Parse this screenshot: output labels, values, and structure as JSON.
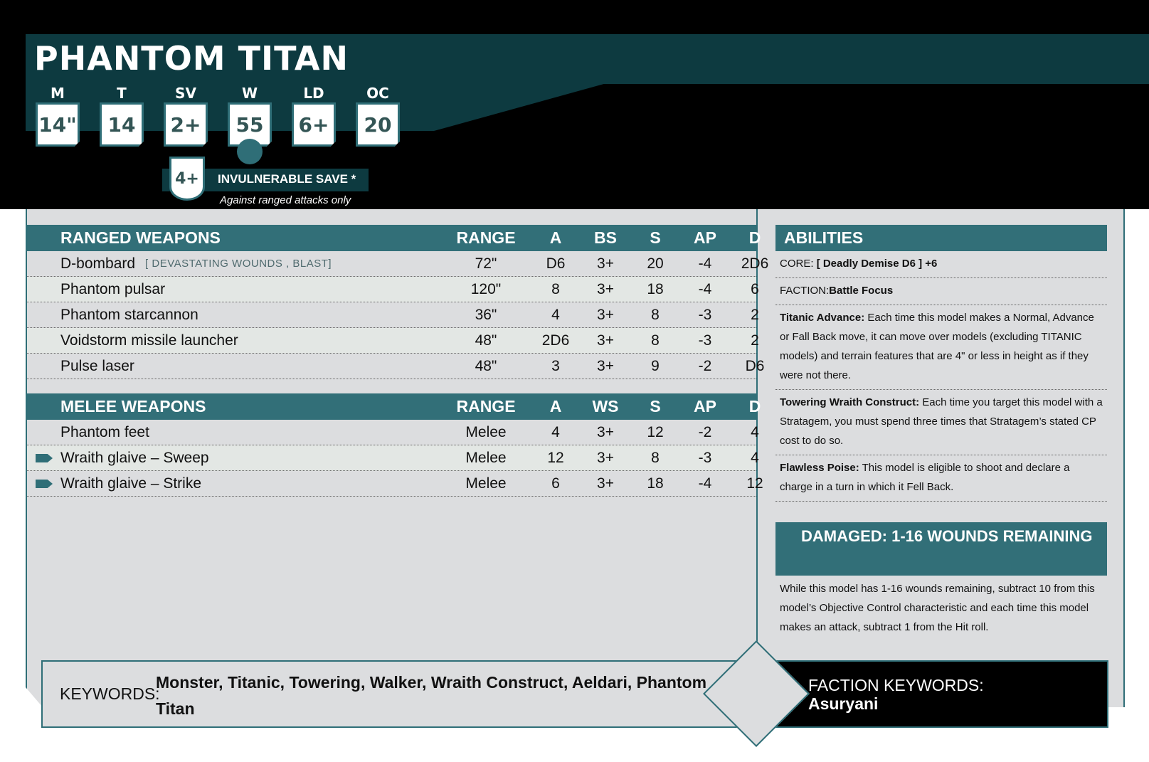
{
  "unit": {
    "name": "PHANTOM TITAN"
  },
  "stats": [
    {
      "label": "M",
      "value": "14\""
    },
    {
      "label": "T",
      "value": "14"
    },
    {
      "label": "SV",
      "value": "2+"
    },
    {
      "label": "W",
      "value": "55"
    },
    {
      "label": "LD",
      "value": "6+"
    },
    {
      "label": "OC",
      "value": "20"
    }
  ],
  "invulnerable": {
    "value": "4+",
    "label": "INVULNERABLE SAVE *",
    "note": "Against ranged attacks only"
  },
  "ranged": {
    "headers": {
      "name": "RANGED WEAPONS",
      "range": "RANGE",
      "a": "A",
      "bs": "BS",
      "s": "S",
      "ap": "AP",
      "d": "D"
    },
    "rows": [
      {
        "name": "D-bombard",
        "keywords": "[ DEVASTATING WOUNDS , BLAST]",
        "range": "72\"",
        "a": "D6",
        "bs": "3+",
        "s": "20",
        "ap": "-4",
        "d": "2D6"
      },
      {
        "name": "Phantom pulsar",
        "keywords": "",
        "range": "120\"",
        "a": "8",
        "bs": "3+",
        "s": "18",
        "ap": "-4",
        "d": "6"
      },
      {
        "name": "Phantom starcannon",
        "keywords": "",
        "range": "36\"",
        "a": "4",
        "bs": "3+",
        "s": "8",
        "ap": "-3",
        "d": "2"
      },
      {
        "name": "Voidstorm missile launcher",
        "keywords": "",
        "range": "48\"",
        "a": "2D6",
        "bs": "3+",
        "s": "8",
        "ap": "-3",
        "d": "2"
      },
      {
        "name": "Pulse laser",
        "keywords": "",
        "range": "48\"",
        "a": "3",
        "bs": "3+",
        "s": "9",
        "ap": "-2",
        "d": "D6"
      }
    ]
  },
  "melee": {
    "headers": {
      "name": "MELEE WEAPONS",
      "range": "RANGE",
      "a": "A",
      "ws": "WS",
      "s": "S",
      "ap": "AP",
      "d": "D"
    },
    "rows": [
      {
        "name": "Phantom feet",
        "range": "Melee",
        "a": "4",
        "ws": "3+",
        "s": "12",
        "ap": "-2",
        "d": "4"
      },
      {
        "name": "Wraith glaive – Sweep",
        "range": "Melee",
        "a": "12",
        "ws": "3+",
        "s": "8",
        "ap": "-3",
        "d": "4"
      },
      {
        "name": "Wraith glaive – Strike",
        "range": "Melee",
        "a": "6",
        "ws": "3+",
        "s": "18",
        "ap": "-4",
        "d": "12"
      }
    ]
  },
  "abilities": {
    "title": "ABILITIES",
    "core_label": "CORE:",
    "core_value": "[ Deadly Demise D6 ] +6",
    "faction_label": "FACTION:",
    "faction_value": "Battle Focus",
    "items": [
      {
        "name": "Titanic Advance:",
        "text": "Each time this model makes a Normal, Advance or Fall Back move, it can move over models (excluding TITANIC models) and terrain features that are 4\" or less in height as if they were not there."
      },
      {
        "name": "Towering Wraith Construct:",
        "text": "Each time you target this model with a Stratagem, you must spend three times that Stratagem’s stated CP cost to do so."
      },
      {
        "name": "Flawless Poise:",
        "text": "This model is eligible to shoot and declare a charge in a turn in which it Fell Back."
      }
    ]
  },
  "damaged": {
    "title": "DAMAGED: 1-16 WOUNDS REMAINING",
    "text": "While this model has 1-16 wounds remaining, subtract 10 from this model’s Objective Control characteristic and each time this model makes an attack, subtract 1 from the Hit roll."
  },
  "keywords": {
    "label": "KEYWORDS:",
    "values": "Monster, Titanic, Towering, Walker, Wraith Construct, Aeldari, Phantom Titan",
    "faction_label": "FACTION KEYWORDS:",
    "faction_value": "Asuryani"
  }
}
